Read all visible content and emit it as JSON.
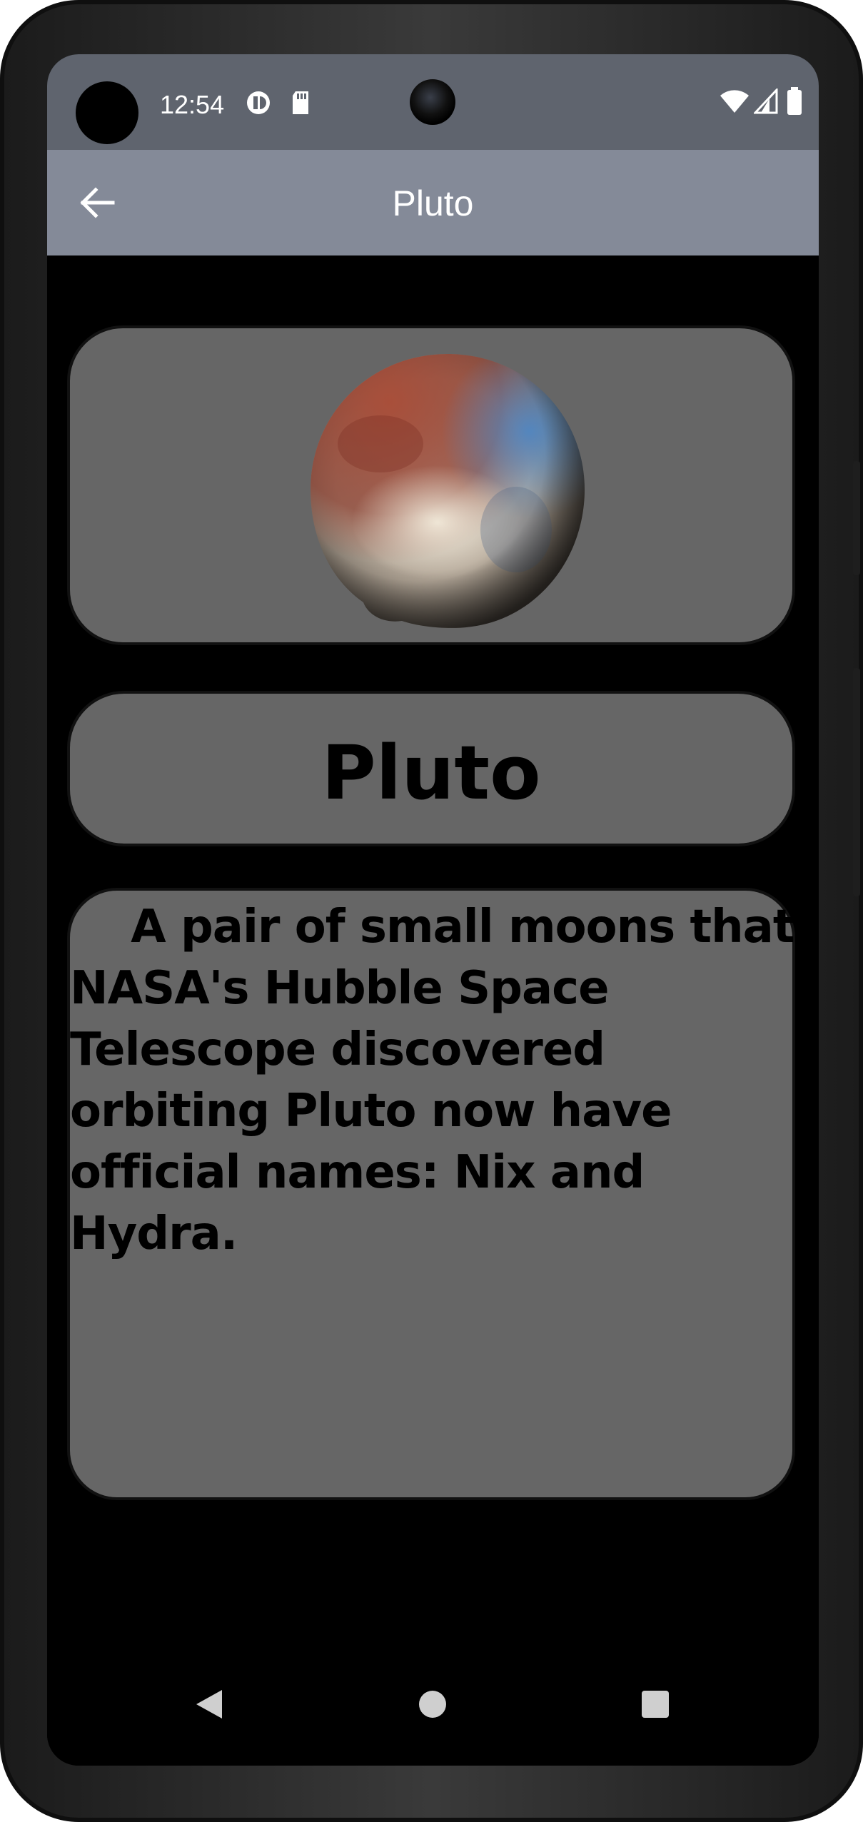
{
  "status_bar": {
    "time": "12:54",
    "icons": [
      "sync-icon",
      "sd-card-icon",
      "wifi-icon",
      "signal-icon",
      "battery-icon"
    ]
  },
  "app_bar": {
    "title": "Pluto",
    "back_icon": "arrow-left-icon"
  },
  "planet": {
    "name": "Pluto",
    "image": "pluto-image",
    "description": "    A pair of small moons that NASA's Hubble Space Telescope discovered orbiting Pluto now have official names: Nix and Hydra."
  },
  "nav_bar": {
    "icons": [
      "back-triangle-icon",
      "home-circle-icon",
      "recents-square-icon"
    ]
  },
  "colors": {
    "status_bar": "#5f646e",
    "app_bar": "#848a98",
    "card": "#666666",
    "background": "#000000"
  }
}
